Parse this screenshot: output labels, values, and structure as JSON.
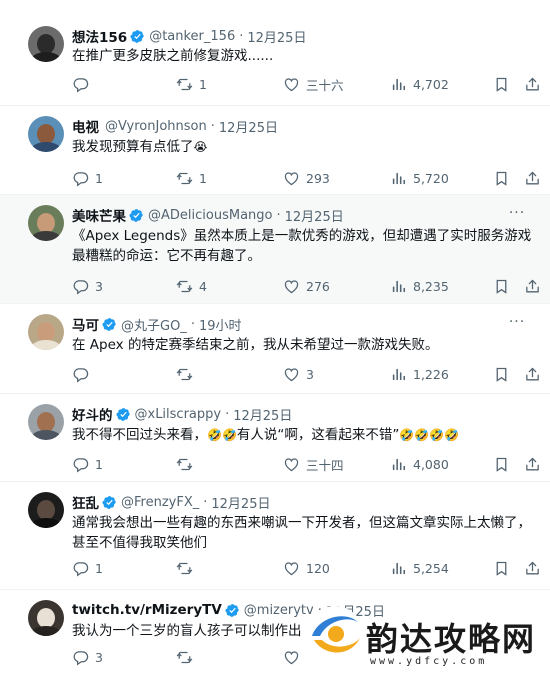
{
  "colors": {
    "verified": "#1d9bf0",
    "text": "#0f1419",
    "muted": "#536471",
    "highlight_bg": "#f7f9f9"
  },
  "tweets": [
    {
      "name": "想法156",
      "verified": true,
      "handle": "@tanker_156",
      "sep": "·",
      "time": "12月25日",
      "text": "在推广更多皮肤之前修复游戏......",
      "replies": "",
      "retweets": "1",
      "likes": "三十六",
      "views": "4,702"
    },
    {
      "name": "电视",
      "verified": false,
      "handle": "@VyronJohnson",
      "sep": "·",
      "time": "12月25日",
      "text": "我发现预算有点低了",
      "replies": "1",
      "retweets": "1",
      "likes": "293",
      "views": "5,720"
    },
    {
      "name": "美味芒果",
      "verified": true,
      "handle": "@ADeliciousMango",
      "sep": "·",
      "time": "12月25日",
      "text": "《Apex Legends》虽然本质上是一款优秀的游戏，但却遭遇了实时服务游戏最糟糕的命运：它不再有趣了。",
      "replies": "3",
      "retweets": "4",
      "likes": "276",
      "views": "8,235"
    },
    {
      "name": "马可",
      "verified": true,
      "handle": "@丸子GO_",
      "sep": "·",
      "time": "19小时",
      "text": "在 Apex 的特定赛季结束之前，我从未希望过一款游戏失败。",
      "replies": "",
      "retweets": "",
      "likes": "3",
      "views": "1,226"
    },
    {
      "name": "好斗的",
      "verified": true,
      "handle": "@xLilscrappy",
      "sep": "·",
      "time": "12月25日",
      "text_a": "我不得不回过头来看，",
      "text_b": "有人说“啊，这看起来不错”",
      "replies": "1",
      "retweets": "",
      "likes": "三十四",
      "views": "4,080"
    },
    {
      "name": "狂乱",
      "verified": true,
      "handle": "@FrenzyFX_",
      "sep": "·",
      "time": "12月25日",
      "text": "通常我会想出一些有趣的东西来嘲讽一下开发者，但这篇文章实际上太懒了，甚至不值得我取笑他们",
      "replies": "1",
      "retweets": "",
      "likes": "120",
      "views": "5,254"
    },
    {
      "name": "twitch.tv/rMizeryTV",
      "verified": true,
      "handle": "@mizerytv",
      "sep": "·",
      "time": "12月25日",
      "text": "我认为一个三岁的盲人孩子可以制作出",
      "replies": "3",
      "retweets": "",
      "likes": "",
      "views": ""
    }
  ],
  "emoji": {
    "crying": "😭",
    "laughing": "🤣"
  },
  "watermark": {
    "title": "韵达攻略网",
    "url": "www.ydfcy.com"
  }
}
